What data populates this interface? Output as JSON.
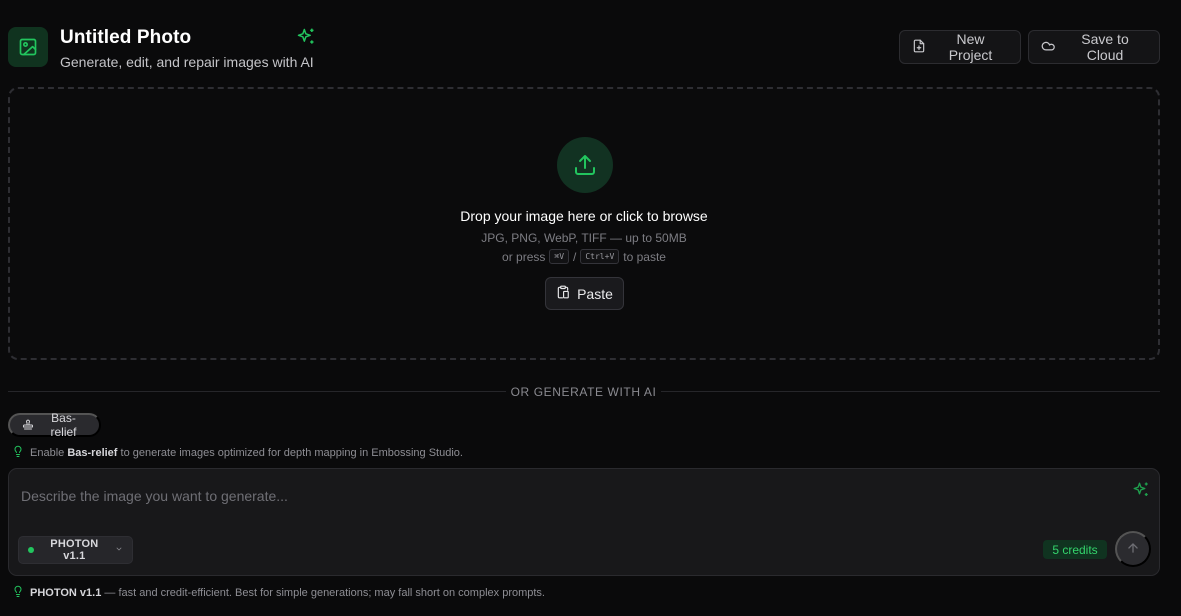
{
  "header": {
    "title": "Untitled Photo",
    "subtitle": "Generate, edit, and repair images with AI",
    "new_project_label": "New Project",
    "save_cloud_label": "Save to Cloud",
    "icons": {
      "app": "image-icon",
      "sparkle": "sparkle-icon",
      "new_project": "file-plus-icon",
      "cloud": "cloud-icon"
    }
  },
  "dropzone": {
    "title": "Drop your image here or click to browse",
    "formats": "JPG, PNG, WebP, TIFF — up to 50MB",
    "paste_prefix": "or press",
    "shortcut_mac": "⌘V",
    "shortcut_sep": "/",
    "shortcut_win": "Ctrl+V",
    "paste_suffix": "to paste",
    "paste_button": "Paste",
    "icons": {
      "upload": "upload-icon",
      "paste": "clipboard-icon"
    }
  },
  "divider": {
    "label": "OR GENERATE WITH AI"
  },
  "bas_relief": {
    "chip_label": "Bas-relief",
    "hint_prefix": "Enable",
    "hint_bold": "Bas-relief",
    "hint_suffix": "to generate images optimized for depth mapping in Embossing Studio."
  },
  "prompt": {
    "placeholder": "Describe the image you want to generate...",
    "model": "PHOTON v1.1",
    "credits": "5 credits"
  },
  "model_hint": {
    "bold": "PHOTON v1.1",
    "text": "— fast and credit-efficient. Best for simple generations; may fall short on complex prompts."
  },
  "colors": {
    "accent": "#22c55e",
    "background": "#0a0a0b",
    "surface": "#18181a"
  }
}
